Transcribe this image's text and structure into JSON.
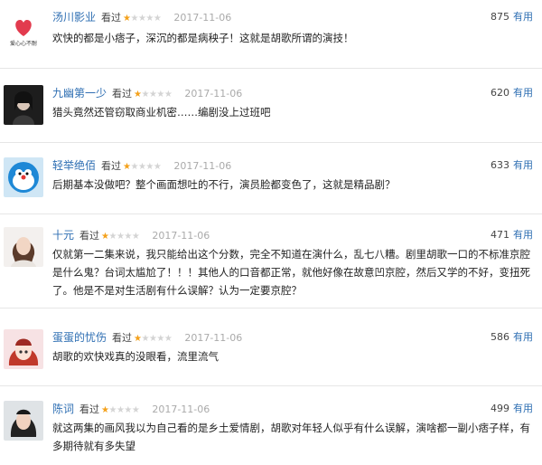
{
  "reviews": [
    {
      "user": "汤川影业",
      "seen": "看过",
      "rating": 1,
      "date": "2017-11-06",
      "votes": "875",
      "useful": "有用",
      "text": "欢快的都是小痞子，深沉的都是病秧子！这就是胡歌所谓的演技！",
      "avatar": {
        "icon": "heart-logo-avatar",
        "caption": "爱心心不耐"
      }
    },
    {
      "user": "九幽第一少",
      "seen": "看过",
      "rating": 1,
      "date": "2017-11-06",
      "votes": "620",
      "useful": "有用",
      "text": "猎头竟然还管窃取商业机密……编剧没上过班吧",
      "avatar": {
        "icon": "dark-portrait-avatar"
      }
    },
    {
      "user": "轻举绝佰",
      "seen": "看过",
      "rating": 1,
      "date": "2017-11-06",
      "votes": "633",
      "useful": "有用",
      "text": "后期基本没做吧？整个画面想吐的不行，演员脸都变色了，这就是精品剧？",
      "avatar": {
        "icon": "cartoon-cat-avatar"
      }
    },
    {
      "user": "十元",
      "seen": "看过",
      "rating": 1,
      "date": "2017-11-06",
      "votes": "471",
      "useful": "有用",
      "text": "仅就第一二集来说，我只能给出这个分数，完全不知道在演什么，乱七八糟。剧里胡歌一口的不标准京腔是什么鬼？台词太尴尬了！！！其他人的口音都正常，就他好像在故意凹京腔，然后又学的不好，变扭死了。他是不是对生活剧有什么误解？认为一定要京腔？",
      "avatar": {
        "icon": "woman-portrait-avatar"
      }
    },
    {
      "user": "蛋蛋的忧伤",
      "seen": "看过",
      "rating": 1,
      "date": "2017-11-06",
      "votes": "586",
      "useful": "有用",
      "text": "胡歌的欢快戏真的没眼看，流里流气",
      "avatar": {
        "icon": "anime-girl-avatar"
      }
    },
    {
      "user": "陈词",
      "seen": "看过",
      "rating": 1,
      "date": "2017-11-06",
      "votes": "499",
      "useful": "有用",
      "text": "就这两集的画风我以为自己看的是乡土爱情剧，胡歌对年轻人似乎有什么误解，演啥都一副小痞子样，有多期待就有多失望",
      "avatar": {
        "icon": "woman-photo-avatar"
      }
    }
  ],
  "colors": {
    "username": "#2f6fb3",
    "star_on": "#f4a11b",
    "star_off": "#d4d4d4",
    "date": "#aaaaaa"
  }
}
